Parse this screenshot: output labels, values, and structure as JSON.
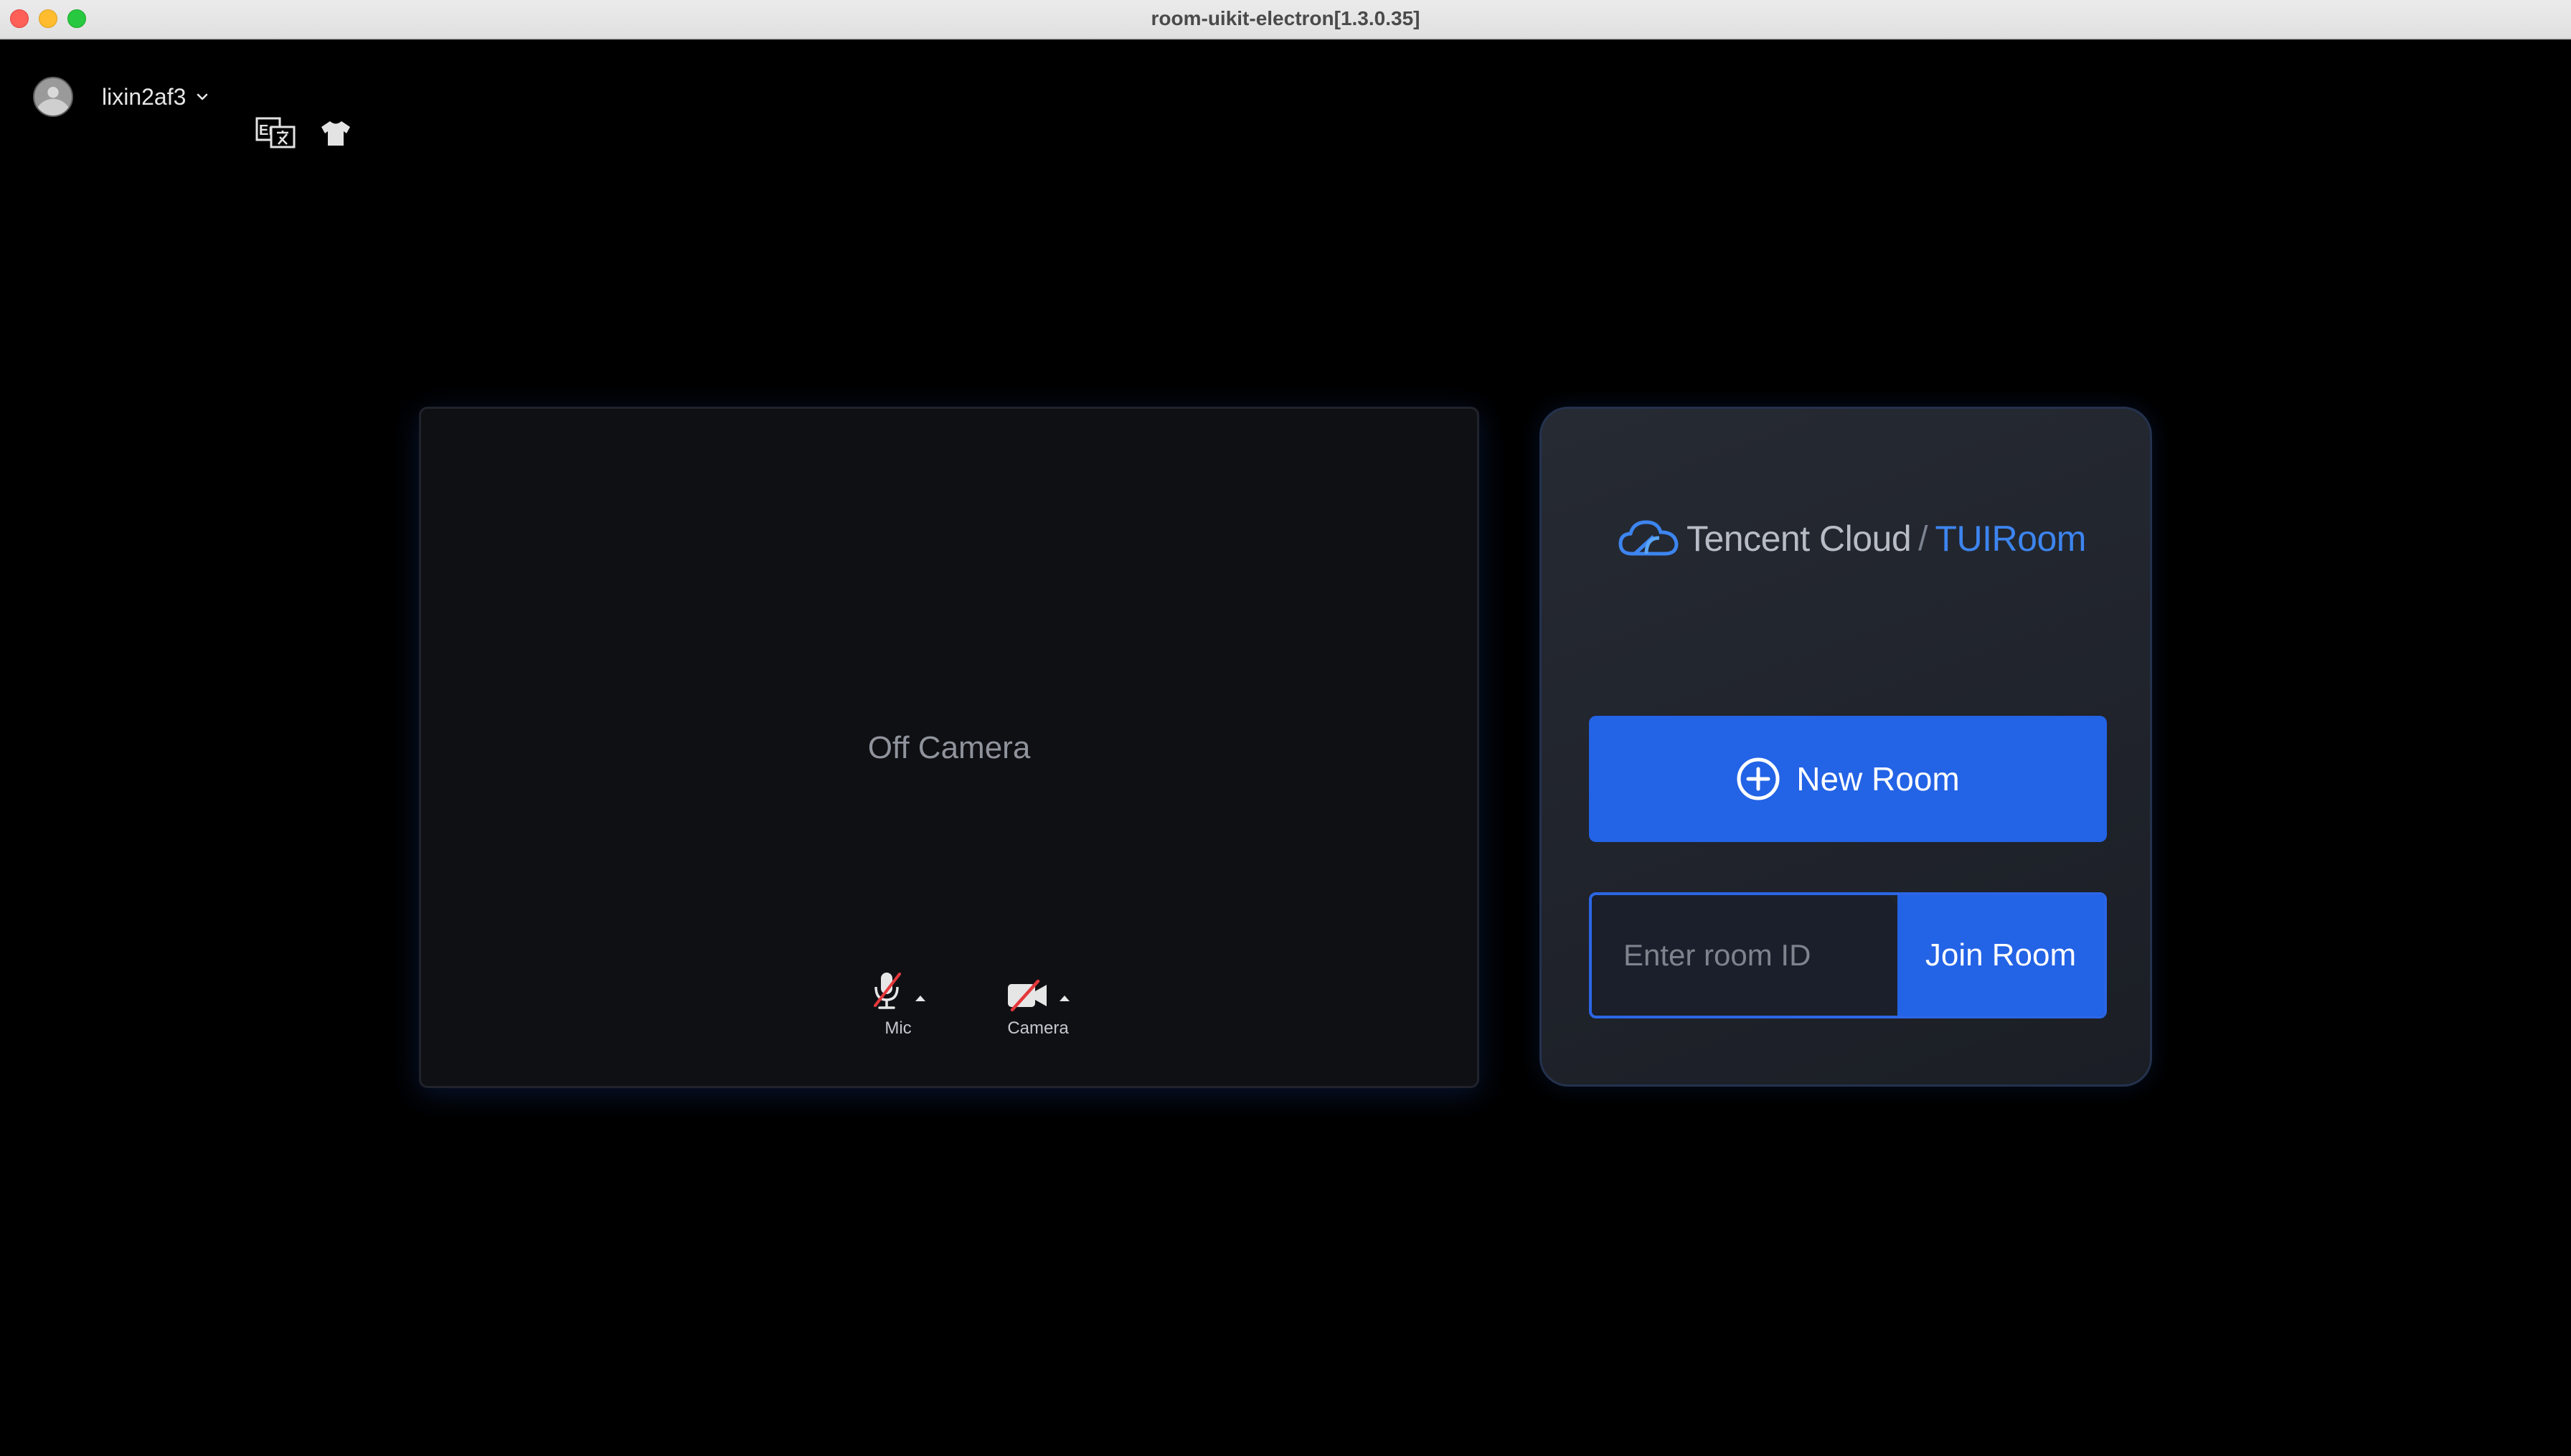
{
  "window": {
    "title": "room-uikit-electron[1.3.0.35]"
  },
  "header": {
    "user_name": "lixin2af3",
    "avatar_icon": "user-avatar",
    "dropdown_icon": "chevron-down-icon",
    "language_icon": "language-switch-icon",
    "theme_icon": "shirt-icon"
  },
  "preview": {
    "status_text": "Off Camera",
    "mic": {
      "label": "Mic",
      "state": "muted"
    },
    "camera": {
      "label": "Camera",
      "state": "off"
    }
  },
  "panel": {
    "logo": {
      "brand": "Tencent Cloud",
      "separator": "/",
      "product": "TUIRoom"
    },
    "new_room_label": "New Room",
    "room_id_placeholder": "Enter room ID",
    "join_room_label": "Join Room"
  },
  "colors": {
    "accent": "#2363e6",
    "background": "#000000",
    "panel": "#1f232b",
    "muted_red": "#e5383b"
  }
}
